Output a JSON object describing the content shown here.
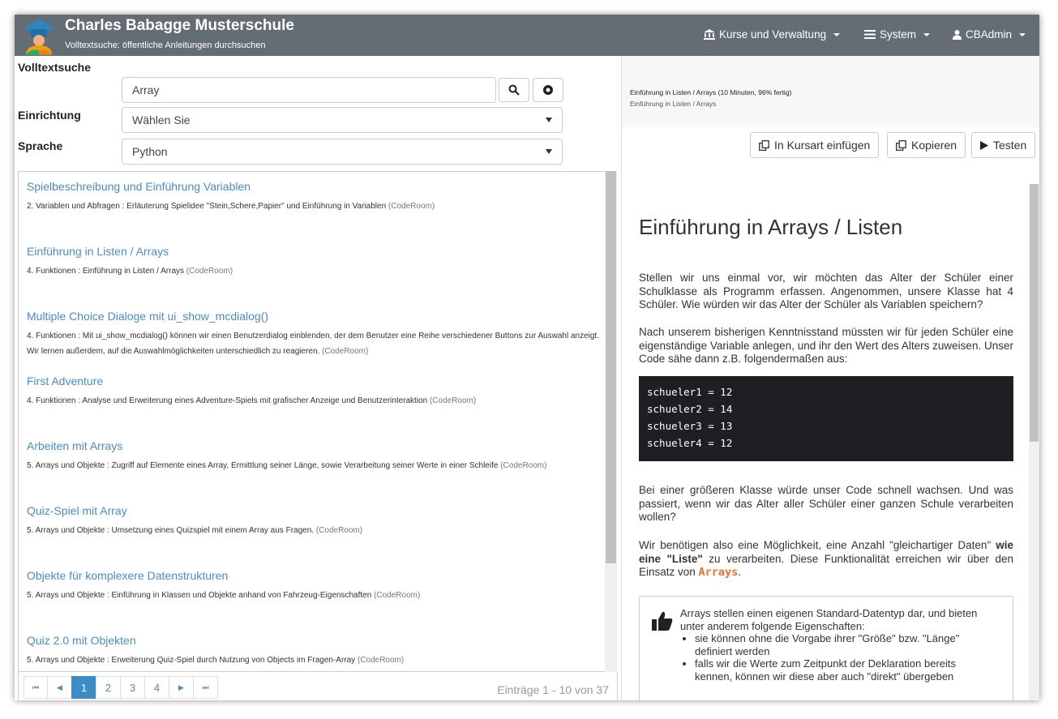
{
  "header": {
    "title": "Charles Babagge Musterschule",
    "subtitle": "Volltextsuche: öffentliche Anleitungen durchsuchen",
    "nav": [
      {
        "label": "Kurse und Verwaltung",
        "icon": "bank-icon"
      },
      {
        "label": "System",
        "icon": "list-icon"
      },
      {
        "label": "CBAdmin",
        "icon": "user-icon"
      }
    ]
  },
  "search": {
    "fulltext_label": "Volltextsuche",
    "fulltext_value": "Array",
    "facility_label": "Einrichtung",
    "facility_value": "Wählen Sie",
    "language_label": "Sprache",
    "language_value": "Python"
  },
  "results": [
    {
      "title": "Spielbeschreibung und Einführung Variablen",
      "desc": "2. Variablen und Abfragen : Erläuterung Spielidee \"Stein,Schere,Papier\" und Einführung in Variablen",
      "src": "(CodeRoom)"
    },
    {
      "title": "Einführung in Listen / Arrays",
      "desc": "4. Funktionen : Einführung in Listen / Arrays",
      "src": "(CodeRoom)"
    },
    {
      "title": "Multiple Choice Dialoge mit ui_show_mcdialog()",
      "desc": "4. Funktionen : Mit ui_show_mcdialog() können wir einen Benutzerdialog einblenden, der dem Benutzer eine Reihe verschiedener Buttons zur Auswahl anzeigt. Wir lernen außerdem, auf die Auswahlmöglichkeiten unterschiedlich zu reagieren.",
      "src": "(CodeRoom)"
    },
    {
      "title": "First Adventure",
      "desc": "4. Funktionen : Analyse und Erweiterung eines Adventure-Spiels mit grafischer Anzeige und Benutzerinteraktion",
      "src": "(CodeRoom)"
    },
    {
      "title": "Arbeiten mit Arrays",
      "desc": "5. Arrays und Objekte : Zugriff auf Elemente eines Array, Ermittlung seiner Länge, sowie Verarbeitung seiner Werte in einer Schleife",
      "src": "(CodeRoom)"
    },
    {
      "title": "Quiz-Spiel mit Array",
      "desc": "5. Arrays und Objekte : Umsetzung eines Quizspiel mit einem Array aus Fragen.",
      "src": "(CodeRoom)"
    },
    {
      "title": "Objekte für komplexere Datenstrukturen",
      "desc": "5. Arrays und Objekte : Einführung in Klassen und Objekte anhand von Fahrzeug-Eigenschaften",
      "src": "(CodeRoom)"
    },
    {
      "title": "Quiz 2.0 mit Objekten",
      "desc": "5. Arrays und Objekte : Erweiterung Quiz-Spiel durch Nutzung von Objects im Fragen-Array",
      "src": "(CodeRoom)"
    }
  ],
  "pager": {
    "first": "⏮",
    "prev": "◀",
    "next": "▶",
    "last": "⏭",
    "pages": [
      "1",
      "2",
      "3",
      "4"
    ],
    "active": "1",
    "info": "Einträge 1 - 10 von 37"
  },
  "detail": {
    "heading_line1": "Einführung in Listen / Arrays (10 Minuten, 96% fertig)",
    "heading_line2": "Einführung in Listen / Arrays",
    "btn_insert": "In Kursart einfügen",
    "btn_copy": "Kopieren",
    "btn_test": "Testen",
    "title": "Einführung in Arrays / Listen",
    "p1": "Stellen wir uns einmal vor, wir möchten das Alter der Schüler einer Schulklasse als Programm erfassen. Angenommen, unsere Klasse hat 4 Schüler.  Wie würden wir das Alter der Schüler als Variablen speichern?",
    "p2": "Nach unserem bisherigen Kenntnisstand müssten wir für jeden Schüler eine eigenständige Variable anlegen, und ihr den Wert des Alters zuweisen. Unser Code sähe dann z.B. folgendermaßen aus:",
    "code": [
      "schueler1 = 12",
      "schueler2 = 14",
      "schueler3 = 13",
      "schueler4 = 12"
    ],
    "p3": "Bei einer größeren Klasse würde unser Code schnell wachsen. Und was passiert, wenn wir das Alter aller Schüler einer ganzen Schule verarbeiten wollen?",
    "p4_a": "Wir benötigen also eine Möglichkeit, eine Anzahl \"gleichartiger Daten\" ",
    "p4_b": "wie eine \"Liste\"",
    "p4_c": " zu verarbeiten. Diese Funktionalität erreichen wir über den Einsatz von ",
    "p4_kw": "Arrays",
    "p4_d": ".",
    "box_intro": "Arrays stellen einen eigenen Standard-Datentyp dar, und bieten unter anderem folgende Eigenschaften:",
    "box_items": [
      "sie können ohne die Vorgabe ihrer \"Größe\" bzw. \"Länge\" definiert werden",
      "falls wir die Werte zum Zeitpunkt der Deklaration bereits kennen, können wir diese aber auch \"direkt\" übergeben"
    ]
  },
  "colors": {
    "header_bg": "#646c74",
    "link": "#4a8bc7",
    "active_page": "#3c8dc5",
    "code_bg": "#1e1f22",
    "keyword": "#e8702a"
  }
}
